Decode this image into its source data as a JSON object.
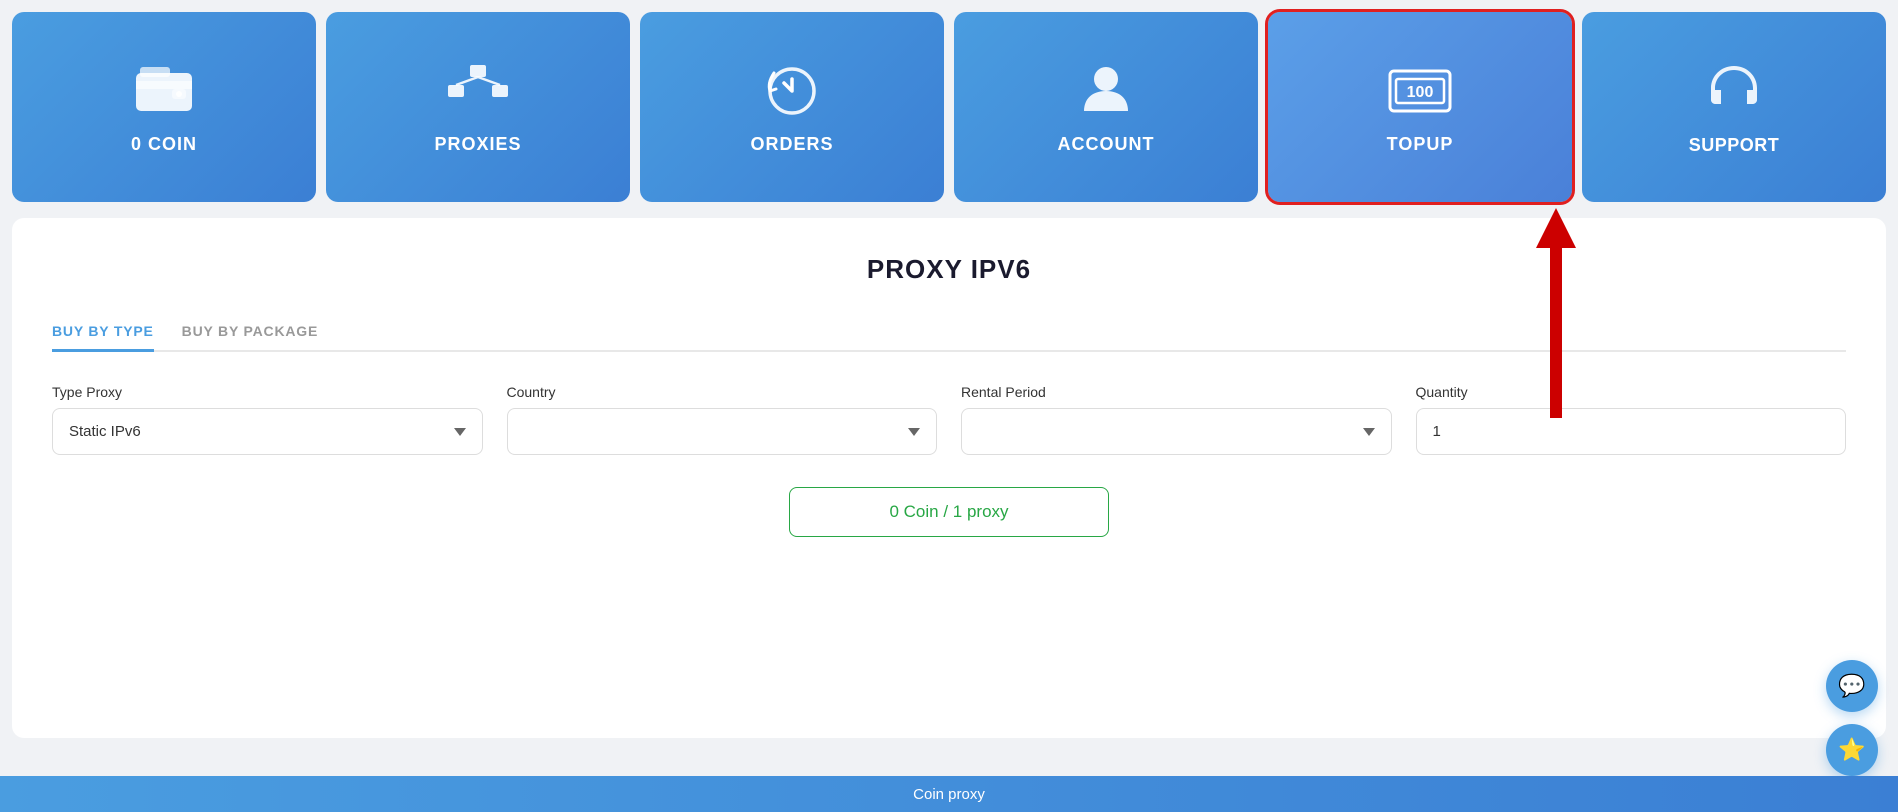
{
  "nav": {
    "cards": [
      {
        "id": "coin",
        "label": "0 COIN",
        "icon": "wallet",
        "active": false
      },
      {
        "id": "proxies",
        "label": "PROXIES",
        "icon": "proxies",
        "active": false
      },
      {
        "id": "orders",
        "label": "ORDERS",
        "icon": "orders",
        "active": false
      },
      {
        "id": "account",
        "label": "ACCOUNT",
        "icon": "account",
        "active": false
      },
      {
        "id": "topup",
        "label": "TOPUP",
        "icon": "topup",
        "active": true
      },
      {
        "id": "support",
        "label": "Support",
        "icon": "support",
        "active": false
      }
    ]
  },
  "main": {
    "title": "PROXY IPV6",
    "tabs": [
      {
        "id": "buy-type",
        "label": "BUY BY TYPE",
        "active": true
      },
      {
        "id": "buy-package",
        "label": "BUY BY PACKAGE",
        "active": false
      }
    ],
    "form": {
      "type_proxy_label": "Type Proxy",
      "type_proxy_value": "Static IPv6",
      "country_label": "Country",
      "country_placeholder": "",
      "rental_period_label": "Rental Period",
      "rental_period_placeholder": "",
      "quantity_label": "Quantity",
      "quantity_value": "1"
    },
    "price_button": "0 Coin / 1 proxy"
  },
  "footer": {
    "label": "Coin proxy"
  },
  "chat_icon": "💬",
  "star_icon": "⭐"
}
